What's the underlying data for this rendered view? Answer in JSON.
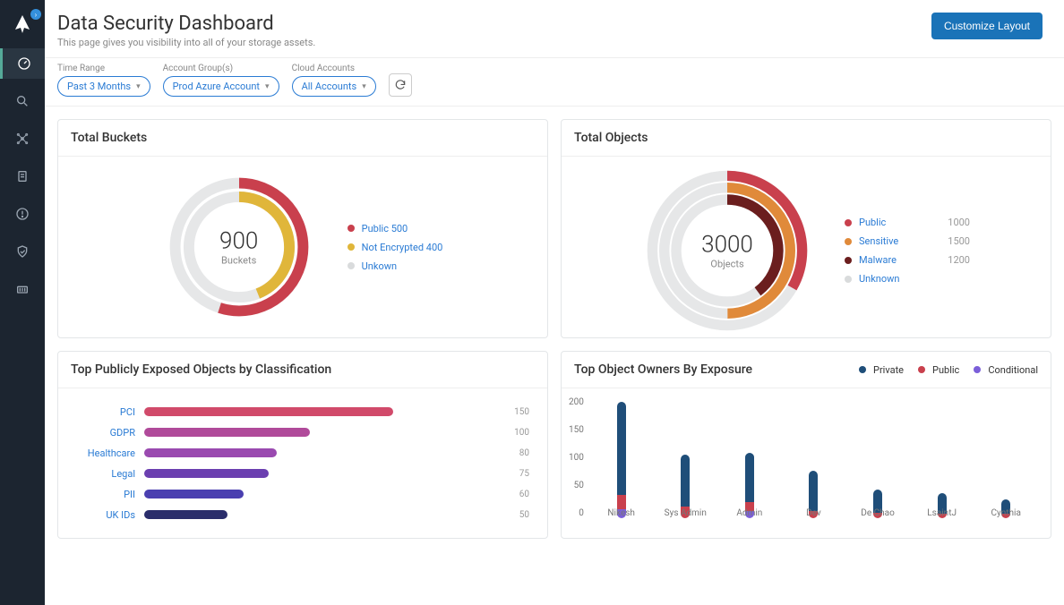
{
  "header": {
    "title": "Data Security Dashboard",
    "subtitle": "This page gives you visibility into all of your storage assets.",
    "customize_btn": "Customize Layout"
  },
  "filters": {
    "time_range": {
      "label": "Time Range",
      "value": "Past 3 Months"
    },
    "account_groups": {
      "label": "Account Group(s)",
      "value": "Prod Azure Account"
    },
    "cloud_accounts": {
      "label": "Cloud Accounts",
      "value": "All Accounts"
    }
  },
  "colors": {
    "red": "#c9404d",
    "yellow": "#e0b63a",
    "orange": "#e08a3a",
    "maroon": "#6b1e1e",
    "gray": "#d9dbdc",
    "navy": "#1f4e79",
    "purple": "#7b5fd9",
    "pink": "#d14a6a",
    "violet0": "#d14a6a",
    "violet1": "#b04a9a",
    "violet2": "#9a4ab0",
    "violet3": "#6b3fb0",
    "violet4": "#4a3fb0",
    "violet5": "#2a2d6b"
  },
  "card_buckets": {
    "title": "Total Buckets",
    "center_value": "900",
    "center_sub": "Buckets",
    "legend": [
      {
        "label": "Public",
        "value": "500",
        "color": "red"
      },
      {
        "label": "Not Encrypted",
        "value": "400",
        "color": "yellow"
      },
      {
        "label": "Unkown",
        "value": "",
        "color": "gray"
      }
    ]
  },
  "card_objects": {
    "title": "Total Objects",
    "center_value": "3000",
    "center_sub": "Objects",
    "legend": [
      {
        "label": "Public",
        "value": "1000",
        "color": "red"
      },
      {
        "label": "Sensitive",
        "value": "1500",
        "color": "orange"
      },
      {
        "label": "Malware",
        "value": "1200",
        "color": "maroon"
      },
      {
        "label": "Unknown",
        "value": "",
        "color": "gray"
      }
    ]
  },
  "card_classification": {
    "title": "Top Publicly Exposed Objects by Classification",
    "items": [
      {
        "label": "PCI",
        "value": 150,
        "color": "violet0"
      },
      {
        "label": "GDPR",
        "value": 100,
        "color": "violet1"
      },
      {
        "label": "Healthcare",
        "value": 80,
        "color": "violet2"
      },
      {
        "label": "Legal",
        "value": 75,
        "color": "violet3"
      },
      {
        "label": "PII",
        "value": 60,
        "color": "violet4"
      },
      {
        "label": "UK IDs",
        "value": 50,
        "color": "violet5"
      }
    ]
  },
  "card_owners": {
    "title": "Top Object Owners By Exposure",
    "legend": [
      {
        "label": "Private",
        "color": "navy"
      },
      {
        "label": "Public",
        "color": "red"
      },
      {
        "label": "Conditional",
        "color": "purple"
      }
    ],
    "ymax": 200,
    "yticks": [
      "200",
      "150",
      "100",
      "50",
      "0"
    ],
    "columns": [
      {
        "label": "Nikesh",
        "private": 160,
        "public": 25,
        "conditional": 15
      },
      {
        "label": "Sys Admin",
        "private": 90,
        "public": 20,
        "conditional": 0
      },
      {
        "label": "Admin",
        "private": 85,
        "public": 15,
        "conditional": 12
      },
      {
        "label": "Dev",
        "private": 70,
        "public": 12,
        "conditional": 0
      },
      {
        "label": "De Chao",
        "private": 40,
        "public": 10,
        "conditional": 0
      },
      {
        "label": "LsaintJ",
        "private": 35,
        "public": 8,
        "conditional": 0
      },
      {
        "label": "Cynthia",
        "private": 25,
        "public": 8,
        "conditional": 0
      }
    ]
  },
  "chart_data": [
    {
      "type": "pie",
      "title": "Total Buckets",
      "total": 900,
      "series": [
        {
          "name": "Public",
          "value": 500
        },
        {
          "name": "Not Encrypted",
          "value": 400
        },
        {
          "name": "Unknown",
          "value": null
        }
      ]
    },
    {
      "type": "pie",
      "title": "Total Objects",
      "total": 3000,
      "series": [
        {
          "name": "Public",
          "value": 1000
        },
        {
          "name": "Sensitive",
          "value": 1500
        },
        {
          "name": "Malware",
          "value": 1200
        },
        {
          "name": "Unknown",
          "value": null
        }
      ]
    },
    {
      "type": "bar",
      "title": "Top Publicly Exposed Objects by Classification",
      "categories": [
        "PCI",
        "GDPR",
        "Healthcare",
        "Legal",
        "PII",
        "UK IDs"
      ],
      "values": [
        150,
        100,
        80,
        75,
        60,
        50
      ],
      "xlabel": "",
      "ylabel": ""
    },
    {
      "type": "bar",
      "title": "Top Object Owners By Exposure",
      "categories": [
        "Nikesh",
        "Sys Admin",
        "Admin",
        "Dev",
        "De Chao",
        "LsaintJ",
        "Cynthia"
      ],
      "series": [
        {
          "name": "Private",
          "values": [
            160,
            90,
            85,
            70,
            40,
            35,
            25
          ]
        },
        {
          "name": "Public",
          "values": [
            25,
            20,
            15,
            12,
            10,
            8,
            8
          ]
        },
        {
          "name": "Conditional",
          "values": [
            15,
            0,
            12,
            0,
            0,
            0,
            0
          ]
        }
      ],
      "ylim": [
        0,
        200
      ]
    }
  ]
}
